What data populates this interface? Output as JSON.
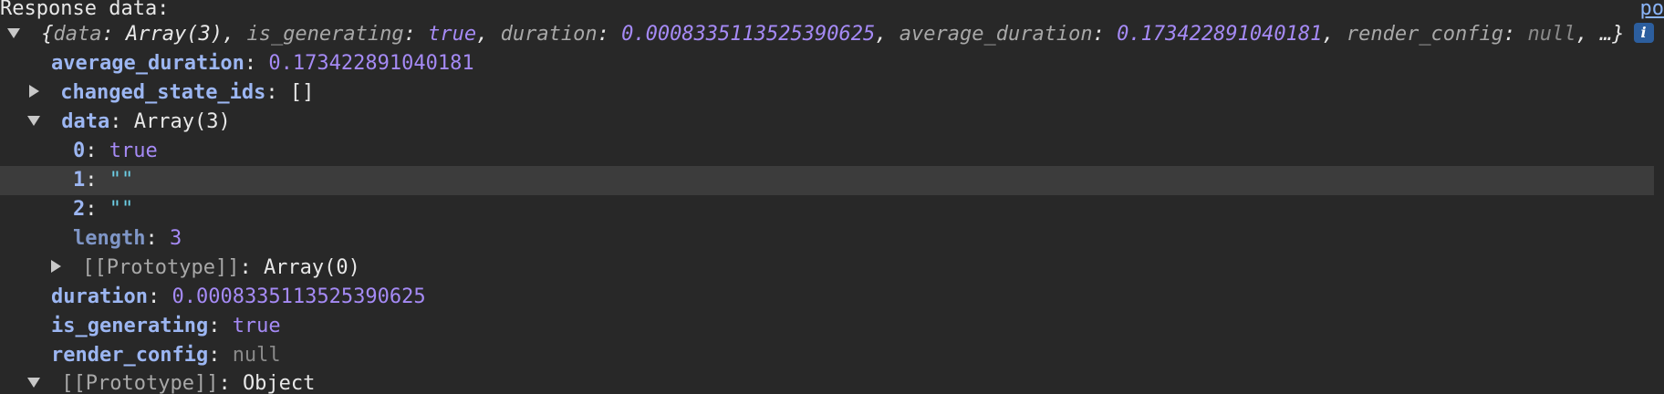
{
  "header": {
    "title": "Response data:",
    "link": "po"
  },
  "summary": {
    "open_brace": "{",
    "k_data": "data",
    "v_data": "Array(3)",
    "k_is_generating": "is_generating",
    "v_is_generating": "true",
    "k_duration": "duration",
    "v_duration": "0.0008335113525390625",
    "k_average_duration": "average_duration",
    "v_average_duration": "0.173422891040181",
    "k_render_config": "render_config",
    "v_render_config": "null",
    "ellipsis": "…}",
    "info": "i"
  },
  "rows": {
    "average_duration": {
      "key": "average_duration",
      "value": "0.173422891040181"
    },
    "changed_state_ids": {
      "key": "changed_state_ids",
      "value": "[]"
    },
    "data": {
      "key": "data",
      "value": "Array(3)"
    },
    "data_0": {
      "key": "0",
      "value": "true"
    },
    "data_1": {
      "key": "1",
      "value": "\"\""
    },
    "data_2": {
      "key": "2",
      "value": "\"\""
    },
    "data_length": {
      "key": "length",
      "value": "3"
    },
    "data_proto": {
      "key": "[[Prototype]]",
      "value": "Array(0)"
    },
    "duration": {
      "key": "duration",
      "value": "0.0008335113525390625"
    },
    "is_generating": {
      "key": "is_generating",
      "value": "true"
    },
    "render_config": {
      "key": "render_config",
      "value": "null"
    },
    "object_proto": {
      "key": "[[Prototype]]",
      "value": "Object"
    }
  },
  "colors": {
    "background": "#282828",
    "key": "#9cb6f2",
    "number": "#a58af5",
    "string": "#6dcfe6",
    "null": "#8a8a8a",
    "highlight_row": "#3c3c3c"
  },
  "icons": {
    "expanded": "triangle-down-icon",
    "collapsed": "triangle-right-icon",
    "info": "info-icon"
  }
}
